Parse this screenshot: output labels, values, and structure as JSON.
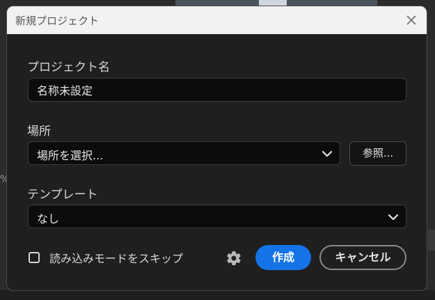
{
  "background": {
    "left_fragment": "%"
  },
  "dialog": {
    "title": "新規プロジェクト",
    "close_icon": "close-icon",
    "project_name": {
      "label": "プロジェクト名",
      "value": "名称未設定"
    },
    "location": {
      "label": "場所",
      "selected": "場所を選択...",
      "browse": "参照..."
    },
    "template": {
      "label": "テンプレート",
      "selected": "なし"
    },
    "skip_import": {
      "label": "読み込みモードをスキップ",
      "checked": false
    },
    "settings_icon": "gear-icon",
    "create": "作成",
    "cancel": "キャンセル",
    "accent": "#1473e6"
  }
}
